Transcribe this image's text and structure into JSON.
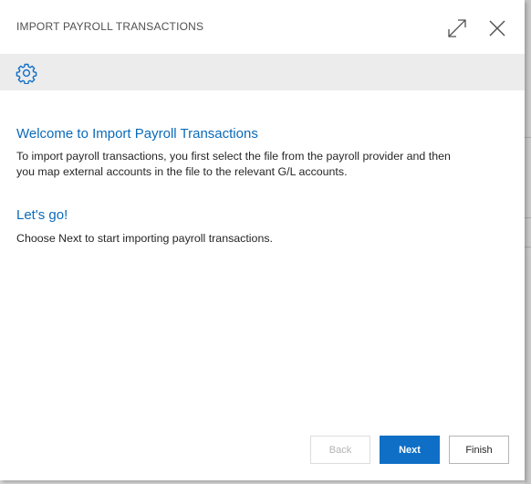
{
  "dialog": {
    "title": "IMPORT PAYROLL TRANSACTIONS",
    "expand_icon": "expand-diagonal-icon",
    "close_icon": "close-icon"
  },
  "action_bar": {
    "settings_icon": "gear-icon"
  },
  "content": {
    "welcome_heading": "Welcome to Import Payroll Transactions",
    "welcome_line1": "To import payroll transactions, you first select the file from the payroll provider and then",
    "welcome_line2": "you map external accounts in the file to the relevant G/L accounts.",
    "go_heading": "Let's go!",
    "go_text": "Choose Next to start importing payroll transactions."
  },
  "footer": {
    "back_label": "Back",
    "next_label": "Next",
    "finish_label": "Finish"
  },
  "colors": {
    "accent": "#0f6fc6",
    "heading": "#0b6ab8",
    "action_bar": "#ececec"
  }
}
